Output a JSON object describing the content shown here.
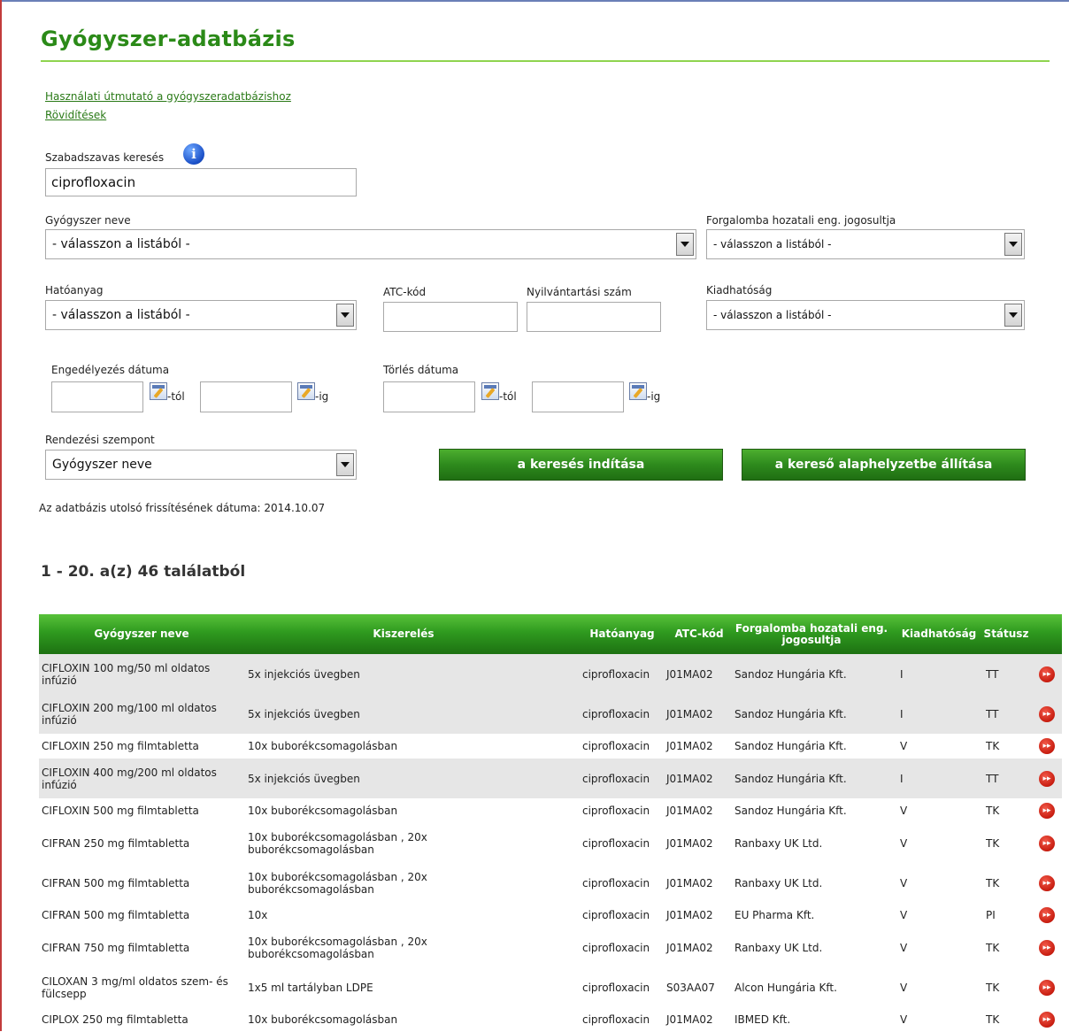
{
  "page": {
    "title": "Gyógyszer-adatbázis",
    "links": [
      "Használati útmutató a gyógyszeradatbázishoz",
      "Rövidítések"
    ]
  },
  "search": {
    "free_text_label": "Szabadszavas keresés",
    "free_text_value": "ciprofloxacin",
    "drug_name_label": "Gyógyszer neve",
    "drug_name_value": "- válasszon a listából -",
    "holder_label": "Forgalomba hozatali eng. jogosultja",
    "holder_value": "- válasszon a listából -",
    "substance_label": "Hatóanyag",
    "substance_value": "- válasszon a listából -",
    "atc_label": "ATC-kód",
    "reg_label": "Nyilvántartási szám",
    "dispense_label": "Kiadhatóság",
    "dispense_value": "- válasszon a listából -",
    "approval_label": "Engedélyezés dátuma",
    "deletion_label": "Törlés dátuma",
    "from_suffix": "-tól",
    "to_suffix": "-ig",
    "sort_label": "Rendezési szempont",
    "sort_value": "Gyógyszer neve",
    "search_button": "a keresés indítása",
    "reset_button": "a kereső alaphelyzetbe állítása",
    "updated_text": "Az adatbázis utolsó frissítésének dátuma: 2014.10.07"
  },
  "results": {
    "heading": "1 - 20. a(z) 46 találatból",
    "columns": [
      "Gyógyszer neve",
      "Kiszerelés",
      "Hatóanyag",
      "ATC-kód",
      "Forgalomba hozatali eng. jogosultja",
      "Kiadhatóság",
      "Státusz"
    ],
    "rows": [
      {
        "name": "CIFLOXIN 100 mg/50 ml oldatos infúzió",
        "pack": "5x injekciós üvegben",
        "substance": "ciprofloxacin",
        "atc": "J01MA02",
        "holder": "Sandoz Hungária Kft.",
        "dispense": "I",
        "status": "TT"
      },
      {
        "name": "CIFLOXIN 200 mg/100 ml oldatos infúzió",
        "pack": "5x injekciós üvegben",
        "substance": "ciprofloxacin",
        "atc": "J01MA02",
        "holder": "Sandoz Hungária Kft.",
        "dispense": "I",
        "status": "TT"
      },
      {
        "name": "CIFLOXIN 250 mg filmtabletta",
        "pack": "10x buborékcsomagolásban",
        "substance": "ciprofloxacin",
        "atc": "J01MA02",
        "holder": "Sandoz Hungária Kft.",
        "dispense": "V",
        "status": "TK"
      },
      {
        "name": "CIFLOXIN 400 mg/200 ml oldatos infúzió",
        "pack": "5x injekciós üvegben",
        "substance": "ciprofloxacin",
        "atc": "J01MA02",
        "holder": "Sandoz Hungária Kft.",
        "dispense": "I",
        "status": "TT"
      },
      {
        "name": "CIFLOXIN 500 mg filmtabletta",
        "pack": "10x buborékcsomagolásban",
        "substance": "ciprofloxacin",
        "atc": "J01MA02",
        "holder": "Sandoz Hungária Kft.",
        "dispense": "V",
        "status": "TK"
      },
      {
        "name": "CIFRAN 250 mg filmtabletta",
        "pack": "10x buborékcsomagolásban , 20x buborékcsomagolásban",
        "substance": "ciprofloxacin",
        "atc": "J01MA02",
        "holder": "Ranbaxy UK Ltd.",
        "dispense": "V",
        "status": "TK"
      },
      {
        "name": "CIFRAN 500 mg filmtabletta",
        "pack": "10x buborékcsomagolásban , 20x buborékcsomagolásban",
        "substance": "ciprofloxacin",
        "atc": "J01MA02",
        "holder": "Ranbaxy UK Ltd.",
        "dispense": "V",
        "status": "TK"
      },
      {
        "name": "CIFRAN 500 mg filmtabletta",
        "pack": "10x",
        "substance": "ciprofloxacin",
        "atc": "J01MA02",
        "holder": "EU Pharma Kft.",
        "dispense": "V",
        "status": "PI"
      },
      {
        "name": "CIFRAN 750 mg filmtabletta",
        "pack": "10x buborékcsomagolásban , 20x buborékcsomagolásban",
        "substance": "ciprofloxacin",
        "atc": "J01MA02",
        "holder": "Ranbaxy UK Ltd.",
        "dispense": "V",
        "status": "TK"
      },
      {
        "name": "CILOXAN 3 mg/ml oldatos szem- és fülcsepp",
        "pack": "1x5 ml tartályban LDPE",
        "substance": "ciprofloxacin",
        "atc": "S03AA07",
        "holder": "Alcon Hungária Kft.",
        "dispense": "V",
        "status": "TK"
      },
      {
        "name": "CIPLOX 250 mg filmtabletta",
        "pack": "10x buborékcsomagolásban",
        "substance": "ciprofloxacin",
        "atc": "J01MA02",
        "holder": "IBMED Kft.",
        "dispense": "V",
        "status": "TK"
      }
    ]
  }
}
